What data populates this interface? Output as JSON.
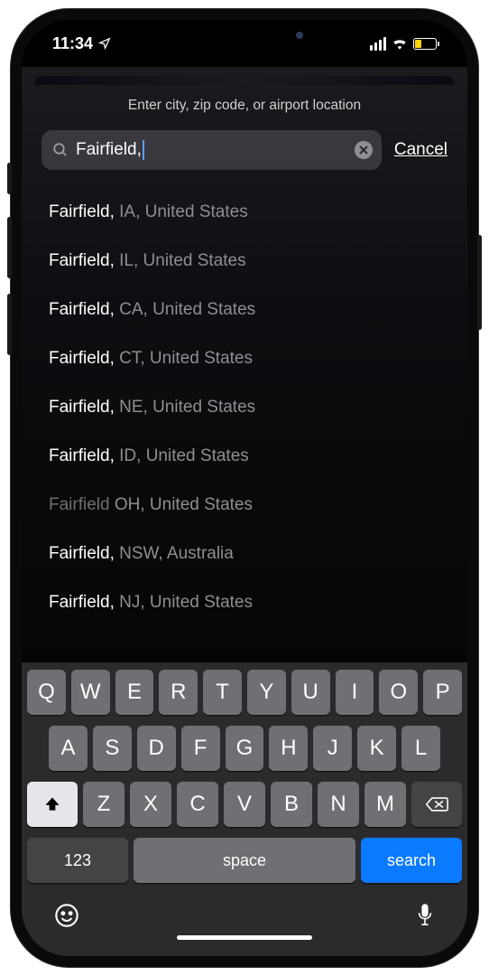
{
  "status": {
    "time": "11:34"
  },
  "search": {
    "prompt": "Enter city, zip code, or airport location",
    "value": "Fairfield, ",
    "cancel_label": "Cancel"
  },
  "results": [
    {
      "primary": "Fairfield,",
      "secondary": " IA, United States",
      "dim": false
    },
    {
      "primary": "Fairfield,",
      "secondary": " IL, United States",
      "dim": false
    },
    {
      "primary": "Fairfield,",
      "secondary": " CA, United States",
      "dim": false
    },
    {
      "primary": "Fairfield,",
      "secondary": " CT, United States",
      "dim": false
    },
    {
      "primary": "Fairfield,",
      "secondary": " NE, United States",
      "dim": false
    },
    {
      "primary": "Fairfield,",
      "secondary": " ID, United States",
      "dim": false
    },
    {
      "primary": "Fairfield",
      "secondary": " OH, United States",
      "dim": true
    },
    {
      "primary": "Fairfield,",
      "secondary": " NSW, Australia",
      "dim": false
    },
    {
      "primary": "Fairfield,",
      "secondary": " NJ, United States",
      "dim": false
    }
  ],
  "keyboard": {
    "row1": [
      "Q",
      "W",
      "E",
      "R",
      "T",
      "Y",
      "U",
      "I",
      "O",
      "P"
    ],
    "row2": [
      "A",
      "S",
      "D",
      "F",
      "G",
      "H",
      "J",
      "K",
      "L"
    ],
    "row3": [
      "Z",
      "X",
      "C",
      "V",
      "B",
      "N",
      "M"
    ],
    "numbers_label": "123",
    "space_label": "space",
    "action_label": "search"
  }
}
